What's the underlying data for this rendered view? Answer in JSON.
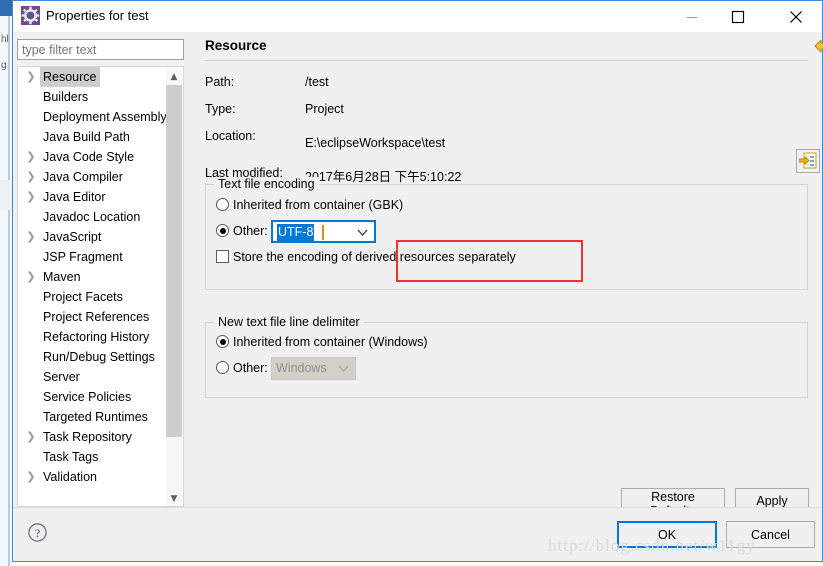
{
  "window": {
    "title": "Properties for test",
    "icon": "properties-gear-icon",
    "controls": {
      "minimize": "minimize-icon",
      "maximize": "maximize-icon",
      "close": "close-icon"
    },
    "border_color": "#3c8ad9"
  },
  "sidebar": {
    "filter": {
      "placeholder": "type filter text",
      "value": ""
    },
    "items": [
      {
        "label": "Resource",
        "expandable": true,
        "selected": true
      },
      {
        "label": "Builders",
        "expandable": false,
        "selected": false
      },
      {
        "label": "Deployment Assembly",
        "expandable": false,
        "selected": false
      },
      {
        "label": "Java Build Path",
        "expandable": false,
        "selected": false
      },
      {
        "label": "Java Code Style",
        "expandable": true,
        "selected": false
      },
      {
        "label": "Java Compiler",
        "expandable": true,
        "selected": false
      },
      {
        "label": "Java Editor",
        "expandable": true,
        "selected": false
      },
      {
        "label": "Javadoc Location",
        "expandable": false,
        "selected": false
      },
      {
        "label": "JavaScript",
        "expandable": true,
        "selected": false
      },
      {
        "label": "JSP Fragment",
        "expandable": false,
        "selected": false
      },
      {
        "label": "Maven",
        "expandable": true,
        "selected": false
      },
      {
        "label": "Project Facets",
        "expandable": false,
        "selected": false
      },
      {
        "label": "Project References",
        "expandable": false,
        "selected": false
      },
      {
        "label": "Refactoring History",
        "expandable": false,
        "selected": false
      },
      {
        "label": "Run/Debug Settings",
        "expandable": false,
        "selected": false
      },
      {
        "label": "Server",
        "expandable": false,
        "selected": false
      },
      {
        "label": "Service Policies",
        "expandable": false,
        "selected": false
      },
      {
        "label": "Targeted Runtimes",
        "expandable": false,
        "selected": false
      },
      {
        "label": "Task Repository",
        "expandable": true,
        "selected": false
      },
      {
        "label": "Task Tags",
        "expandable": false,
        "selected": false
      },
      {
        "label": "Validation",
        "expandable": true,
        "selected": false
      }
    ],
    "scroll": {
      "up": "scroll-up-icon",
      "down": "scroll-down-icon",
      "left": "scroll-left-icon",
      "right": "scroll-right-icon"
    }
  },
  "page": {
    "title": "Resource",
    "nav": {
      "back": "back-arrow-icon",
      "back_menu": "back-dropdown-caret",
      "forward": "forward-arrow-icon",
      "forward_menu": "forward-dropdown-caret",
      "view_menu": "view-menu-caret"
    },
    "info": [
      {
        "label": "Path:",
        "value": "/test"
      },
      {
        "label": "Type:",
        "value": "Project"
      },
      {
        "label": "Location:",
        "value": "E:\\eclipseWorkspace\\test"
      },
      {
        "label": "Last modified:",
        "value": "2017年6月28日 下午5:10:22"
      }
    ],
    "location_button": "edit-location-icon",
    "encoding_group": {
      "title": "Text file encoding",
      "inherited_label": "Inherited from container (GBK)",
      "inherited_selected": false,
      "other_label": "Other:",
      "other_selected": true,
      "other_value": "UTF-8",
      "store_derived_label": "Store the encoding of derived resources separately",
      "store_derived_checked": false,
      "highlight_color": "#f0332f",
      "selection_color": "#0078d7"
    },
    "delimiter_group": {
      "title": "New text file line delimiter",
      "inherited_label": "Inherited from container (Windows)",
      "inherited_selected": true,
      "other_label": "Other:",
      "other_selected": false,
      "other_value": "Windows",
      "other_disabled": true
    },
    "restore_defaults_label": "Restore Defaults",
    "apply_label": "Apply"
  },
  "footer": {
    "help": "help-icon",
    "ok_label": "OK",
    "cancel_label": "Cancel",
    "watermark": "http://blog.csdn.net/w11gy"
  }
}
